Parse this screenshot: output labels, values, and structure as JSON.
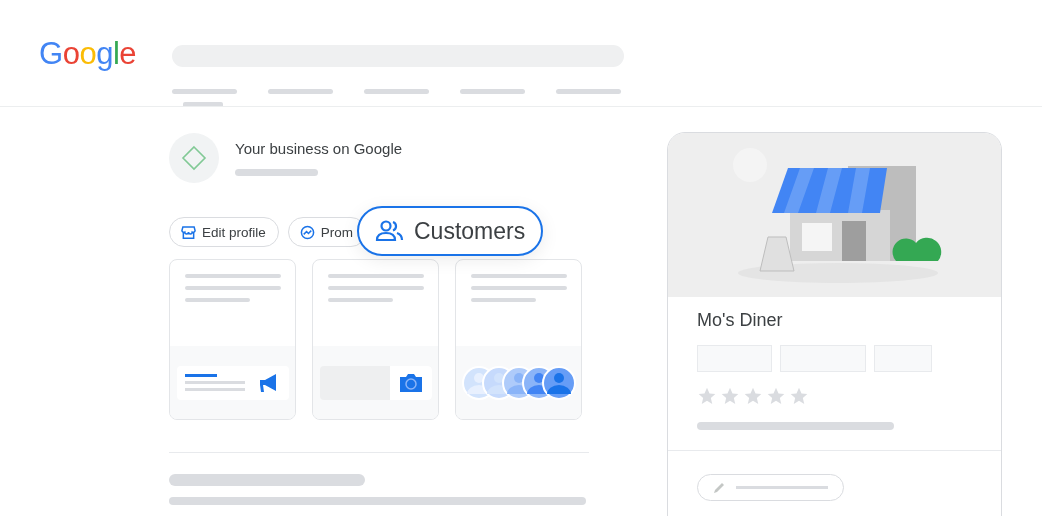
{
  "logo": "Google",
  "business": {
    "title": "Your business on Google"
  },
  "actions": [
    {
      "label": "Edit profile",
      "kind": "store"
    },
    {
      "label": "Prom",
      "kind": "chart"
    }
  ],
  "popup": {
    "label": "Customers"
  },
  "listing": {
    "name": "Mo's Diner",
    "stars": 0
  }
}
